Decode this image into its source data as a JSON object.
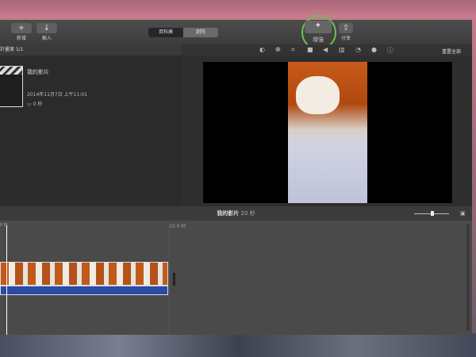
{
  "toolbar": {
    "new_label": "新增",
    "import_label": "輸入",
    "tabs": [
      {
        "label": "資料庫",
        "active": true
      },
      {
        "label": "劇院",
        "active": false
      }
    ],
    "enhance_label": "增強",
    "share_label": "分享"
  },
  "library": {
    "header": "計畫案",
    "count": "1/1",
    "project": {
      "title": "我的影片",
      "date": "2014年11月7日 上午11:01",
      "duration": "0 秒"
    }
  },
  "viewer": {
    "reset_label": "重置全部",
    "tools": [
      "color-balance-icon",
      "color-correction-icon",
      "crop-icon",
      "stabilization-icon",
      "volume-icon",
      "equalizer-icon",
      "speed-icon",
      "noise-reduction-icon",
      "info-icon"
    ]
  },
  "timeline": {
    "title": "我的影片",
    "duration": "20 秒",
    "playhead_label": "0 秒",
    "end_marker": "20.9 秒",
    "zoom_level": 0.5
  },
  "colors": {
    "highlight_ring": "#6cc04a",
    "audio_track": "#2a4aa6"
  }
}
